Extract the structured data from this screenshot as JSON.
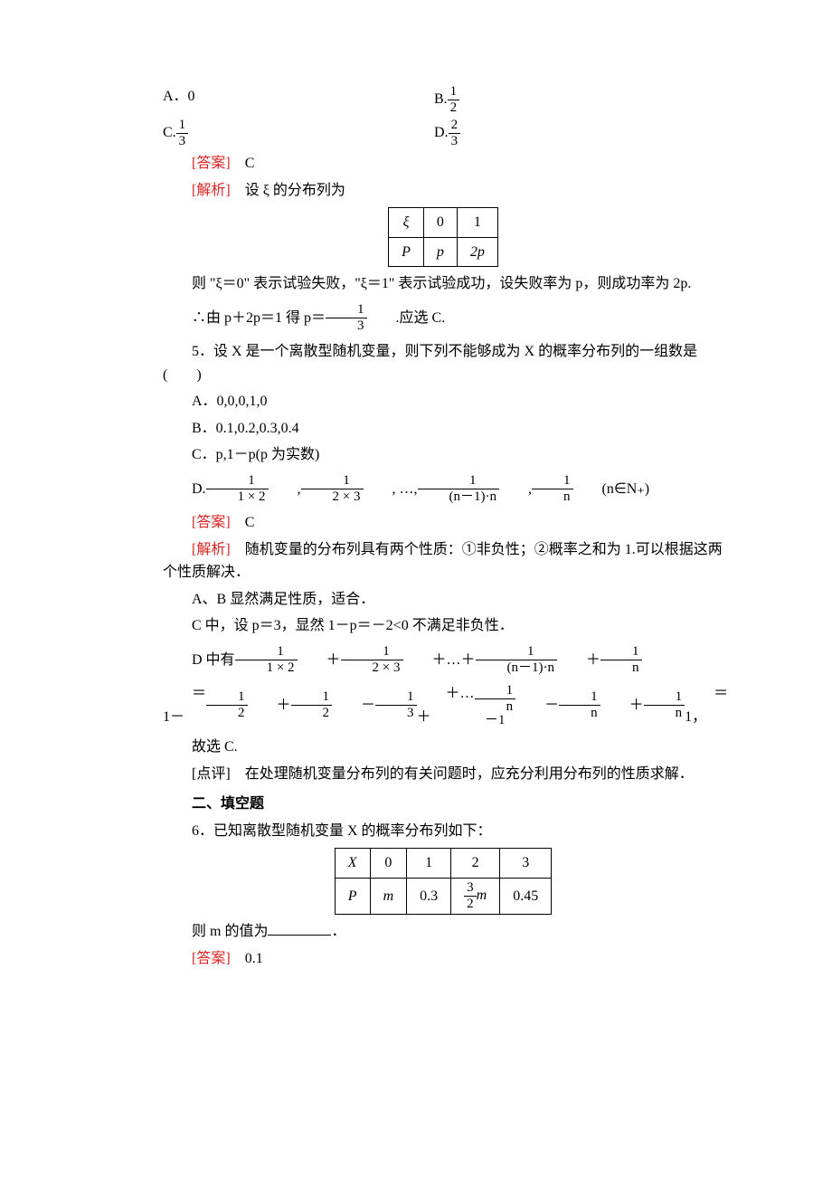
{
  "q4": {
    "opts": {
      "A": "A．0",
      "B_pre": "B.",
      "C_pre": "C.",
      "D_pre": "D."
    },
    "fracs": {
      "half_n": "1",
      "half_d": "2",
      "third_n": "1",
      "third_d": "3",
      "twothirds_n": "2",
      "twothirds_d": "3"
    },
    "ans_label": "[答案]",
    "ans_val": "C",
    "exp_label": "[解析]",
    "exp_intro": "设 ξ 的分布列为",
    "table": {
      "r1c1": "ξ",
      "r1c2": "0",
      "r1c3": "1",
      "r2c1": "P",
      "r2c2": "p",
      "r2c3": "2p"
    },
    "exp_line1": "则 \"ξ＝0\" 表示试验失败，\"ξ＝1\" 表示试验成功，设失败率为 p，则成功率为 2p.",
    "exp_line2_pre": "∴由 p＋2p＝1 得 p＝",
    "exp_line2_post": ".应选 C."
  },
  "q5": {
    "stem": "5．设 X 是一个离散型随机变量，则下列不能够成为 X 的概率分布列的一组数是(　　)",
    "optA": "A．0,0,0,1,0",
    "optB": "B．0.1,0.2,0.3,0.4",
    "optC": "C．p,1－p(p 为实数)",
    "optD_pre": "D.",
    "optD_mid1": ", ",
    "optD_mid2": ", …, ",
    "optD_mid3": ", ",
    "optD_post": "(n∈N₊)",
    "fr": {
      "n1": "1",
      "d1": "1 × 2",
      "n2": "1",
      "d2": "2 × 3",
      "n3": "1",
      "d3": "(n－1)·n",
      "n4": "1",
      "d4": "n"
    },
    "ans_label": "[答案]",
    "ans_val": "C",
    "exp_label": "[解析]",
    "exp1": "随机变量的分布列具有两个性质：①非负性；②概率之和为 1.可以根据这两个性质解决．",
    "exp2": "A、B 显然满足性质，适合．",
    "exp3": "C 中，设 p＝3，显然 1－p＝－2<0 不满足非负性．",
    "exp4_pre": "D 中有",
    "exp4_plus": "＋",
    "exp4_dots": "＋…＋",
    "sum": {
      "n1": "1",
      "d1": "1 × 2",
      "n2": "1",
      "d2": "2 × 3",
      "n3": "1",
      "d3": "(n－1)·n",
      "n4": "1",
      "d4": "n"
    },
    "exp5_pre": "＝1－",
    "exp5_p1": "＋",
    "exp5_m1": "－",
    "exp5_dots": "＋…＋",
    "exp5_end": "＝1，",
    "tele": {
      "h_n": "1",
      "h_d": "2",
      "h2_n": "1",
      "h2_d": "2",
      "t3_n": "1",
      "t3_d": "3",
      "nm1_n": "1",
      "nm1_d": "n－1",
      "n_n": "1",
      "n_d": "n",
      "n2_n": "1",
      "n2_d": "n"
    },
    "exp6": "故选 C.",
    "remark_label": "[点评]",
    "remark": "在处理随机变量分布列的有关问题时，应充分利用分布列的性质求解．"
  },
  "sec2": {
    "title": "二、填空题"
  },
  "q6": {
    "stem": "6．已知离散型随机变量 X 的概率分布列如下：",
    "table": {
      "r1c1": "X",
      "r1c2": "0",
      "r1c3": "1",
      "r1c4": "2",
      "r1c5": "3",
      "r2c1": "P",
      "r2c2": "m",
      "r2c3": "0.3",
      "r2c5": "0.45",
      "frac_n": "3",
      "frac_d": "2",
      "frac_suffix": "m"
    },
    "blank_pre": "则 m 的值为",
    "blank_post": "．",
    "ans_label": "[答案]",
    "ans_val": "0.1"
  }
}
